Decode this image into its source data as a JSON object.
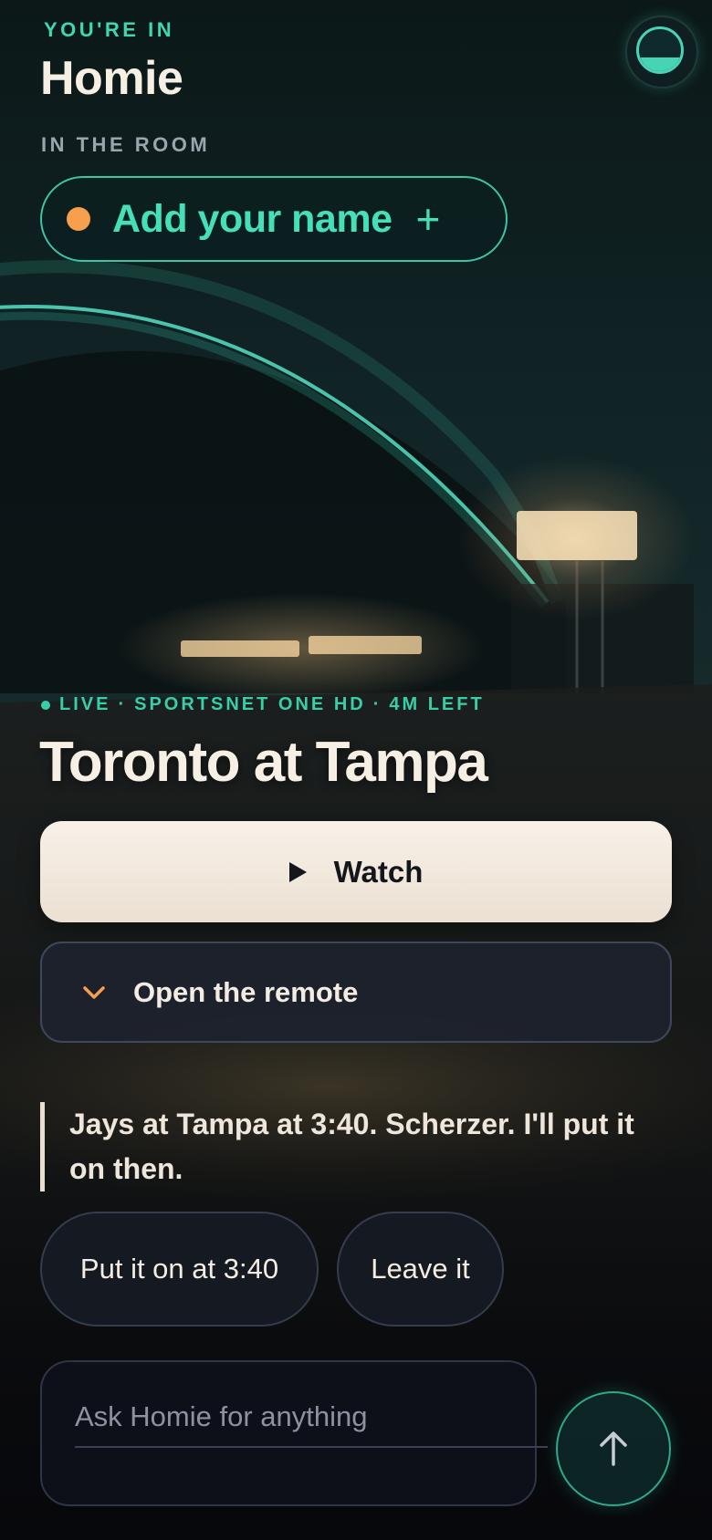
{
  "header": {
    "eyebrow": "YOU'RE IN",
    "room_name": "Homie",
    "room_subtitle": "IN THE ROOM",
    "avatar_icon": "avatar-ring-icon"
  },
  "name_chip": {
    "label": "Add your name",
    "plus": "+",
    "status_color": "#f6a04d"
  },
  "now_playing": {
    "status": "LIVE",
    "channel": "SPORTSNET ONE HD",
    "time_left": "4M LEFT",
    "separator": "·",
    "title": "Toronto at Tampa"
  },
  "actions": {
    "watch_label": "Watch",
    "remote_label": "Open the remote"
  },
  "assistant": {
    "message": "Jays at Tampa at 3:40. Scherzer. I'll put it on then."
  },
  "suggestions": [
    {
      "label": "Put it on at 3:40"
    },
    {
      "label": "Leave it"
    }
  ],
  "composer": {
    "placeholder": "Ask Homie for anything",
    "send_icon": "arrow-up-icon"
  },
  "colors": {
    "accent": "#45e0b8",
    "background": "#0b1414",
    "primary_button": "#f8f1e8"
  }
}
